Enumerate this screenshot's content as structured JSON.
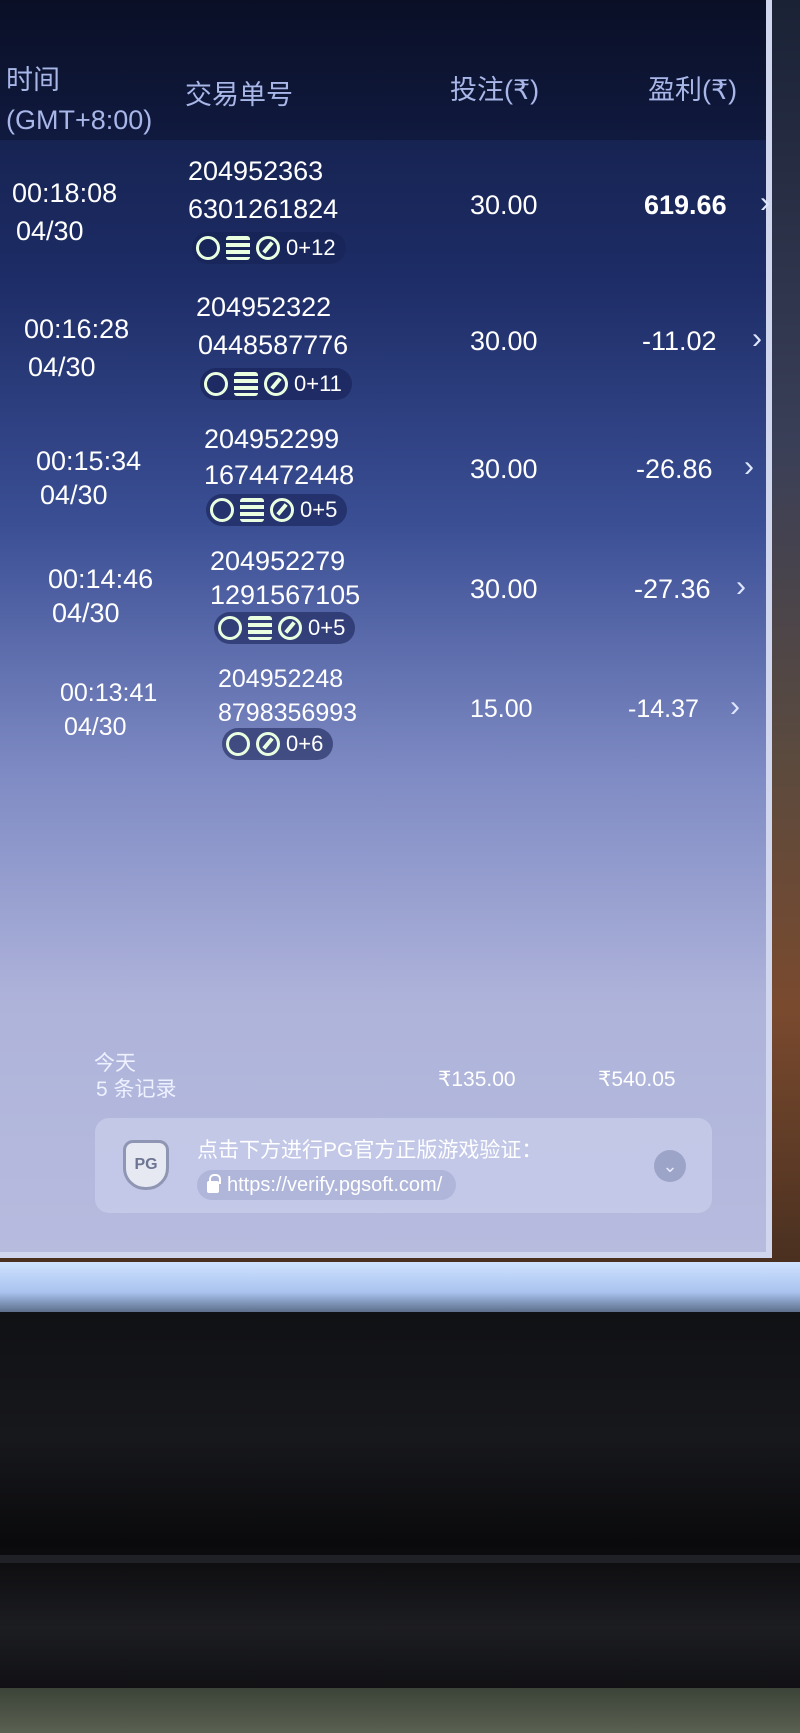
{
  "header": {
    "time_label": "时间",
    "timezone_label": "(GMT+8:00)",
    "id_label": "交易单号",
    "bet_label": "投注(₹)",
    "profit_label": "盈利(₹)"
  },
  "rows": [
    {
      "time": "00:18:08",
      "date": "04/30",
      "id_line1": "204952363",
      "id_line2": "6301261824",
      "badge_count": "0+12",
      "bet": "30.00",
      "profit": "619.66"
    },
    {
      "time": "00:16:28",
      "date": "04/30",
      "id_line1": "204952322",
      "id_line2": "0448587776",
      "badge_count": "0+11",
      "bet": "30.00",
      "profit": "-11.02"
    },
    {
      "time": "00:15:34",
      "date": "04/30",
      "id_line1": "204952299",
      "id_line2": "1674472448",
      "badge_count": "0+5",
      "bet": "30.00",
      "profit": "-26.86"
    },
    {
      "time": "00:14:46",
      "date": "04/30",
      "id_line1": "204952279",
      "id_line2": "1291567105",
      "badge_count": "0+5",
      "bet": "30.00",
      "profit": "-27.36"
    },
    {
      "time": "00:13:41",
      "date": "04/30",
      "id_line1": "204952248",
      "id_line2": "8798356993",
      "badge_count": "0+6",
      "bet": "15.00",
      "profit": "-14.37"
    }
  ],
  "footer": {
    "period_label": "今天",
    "records_label": "5 条记录",
    "total_bet": "₹135.00",
    "total_profit": "₹540.05"
  },
  "verify": {
    "pg_label": "PG",
    "text": "点击下方进行PG官方正版游戏验证：",
    "url": "https://verify.pgsoft.com/"
  },
  "icons": {
    "row_badges": [
      "spin-icon",
      "coin-stack-icon",
      "free-spin-icon"
    ],
    "chevron": "chevron-right-icon",
    "lock": "lock-icon",
    "expand": "chevron-down-icon"
  },
  "colors": {
    "header_bg": "#0a0f26",
    "text": "#ffffff",
    "header_text": "#a8b6e8",
    "badge_icon": "#e9ffe0"
  }
}
